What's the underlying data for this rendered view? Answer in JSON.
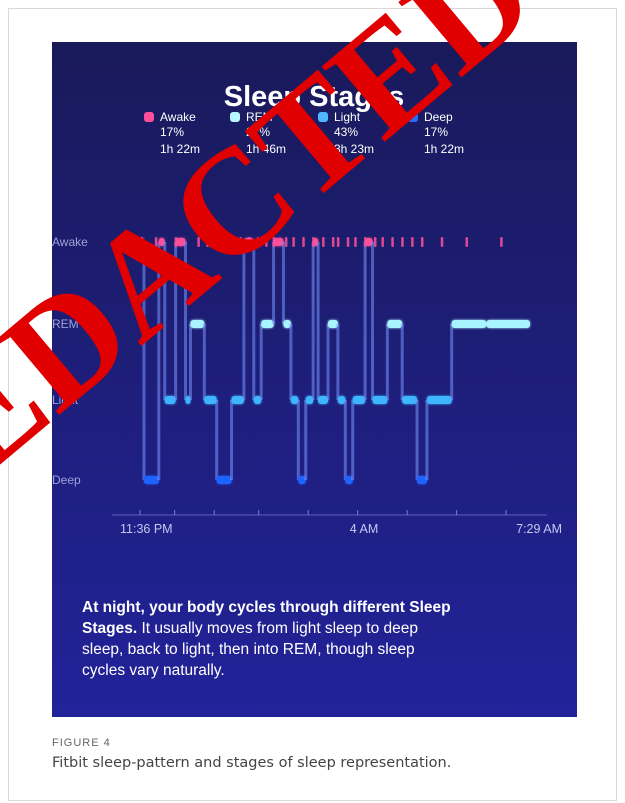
{
  "figure": {
    "caption_label": "FIGURE 4",
    "caption_text": "Fitbit sleep-pattern and stages of sleep representation."
  },
  "watermark": {
    "text": "REDACTED",
    "color": "#e00000"
  },
  "colors": {
    "background_top": "#191a5a",
    "background_bottom": "#22229a",
    "awake": "#ff4f9a",
    "rem": "#a8f4ff",
    "light": "#3db6ff",
    "deep": "#1e63ff"
  },
  "chart_data": {
    "type": "line",
    "title": "Sleep Stages",
    "legend": [
      {
        "stage": "Awake",
        "percent": "17%",
        "duration": "1h 22m",
        "color": "#ff4f9a"
      },
      {
        "stage": "REM",
        "percent": "22%",
        "duration": "1h 46m",
        "color": "#b9f6ff"
      },
      {
        "stage": "Light",
        "percent": "43%",
        "duration": "3h 23m",
        "color": "#4fb6ff"
      },
      {
        "stage": "Deep",
        "percent": "17%",
        "duration": "1h 22m",
        "color": "#2a6bff"
      }
    ],
    "y_categories": [
      "Awake",
      "REM",
      "Light",
      "Deep"
    ],
    "x_tick_labels": [
      "11:36 PM",
      "4 AM",
      "7:29 AM"
    ],
    "x_range_hours": [
      0,
      7.883
    ],
    "awake_markers_hours": [
      0.03,
      0.32,
      0.72,
      1.18,
      1.36,
      1.55,
      1.68,
      1.95,
      2.03,
      2.2,
      2.38,
      2.55,
      2.7,
      2.95,
      3.1,
      3.3,
      3.5,
      3.7,
      3.9,
      4.0,
      4.2,
      4.35,
      4.55,
      4.75,
      4.9,
      5.1,
      5.3,
      5.5,
      5.7,
      6.1,
      6.6,
      7.3
    ],
    "hypnogram": [
      {
        "start": 0.0,
        "end": 0.08,
        "stage": "Awake"
      },
      {
        "start": 0.08,
        "end": 0.38,
        "stage": "Deep"
      },
      {
        "start": 0.38,
        "end": 0.5,
        "stage": "Awake"
      },
      {
        "start": 0.5,
        "end": 0.72,
        "stage": "Light"
      },
      {
        "start": 0.72,
        "end": 0.92,
        "stage": "Awake"
      },
      {
        "start": 0.92,
        "end": 1.02,
        "stage": "Light"
      },
      {
        "start": 1.02,
        "end": 1.3,
        "stage": "REM"
      },
      {
        "start": 1.3,
        "end": 1.55,
        "stage": "Light"
      },
      {
        "start": 1.55,
        "end": 1.85,
        "stage": "Deep"
      },
      {
        "start": 1.85,
        "end": 2.1,
        "stage": "Light"
      },
      {
        "start": 2.1,
        "end": 2.3,
        "stage": "Awake"
      },
      {
        "start": 2.3,
        "end": 2.45,
        "stage": "Light"
      },
      {
        "start": 2.45,
        "end": 2.7,
        "stage": "REM"
      },
      {
        "start": 2.7,
        "end": 2.9,
        "stage": "Awake"
      },
      {
        "start": 2.9,
        "end": 3.05,
        "stage": "REM"
      },
      {
        "start": 3.05,
        "end": 3.2,
        "stage": "Light"
      },
      {
        "start": 3.2,
        "end": 3.35,
        "stage": "Deep"
      },
      {
        "start": 3.35,
        "end": 3.5,
        "stage": "Light"
      },
      {
        "start": 3.5,
        "end": 3.6,
        "stage": "Awake"
      },
      {
        "start": 3.6,
        "end": 3.8,
        "stage": "Light"
      },
      {
        "start": 3.8,
        "end": 4.0,
        "stage": "REM"
      },
      {
        "start": 4.0,
        "end": 4.15,
        "stage": "Light"
      },
      {
        "start": 4.15,
        "end": 4.3,
        "stage": "Deep"
      },
      {
        "start": 4.3,
        "end": 4.55,
        "stage": "Light"
      },
      {
        "start": 4.55,
        "end": 4.7,
        "stage": "Awake"
      },
      {
        "start": 4.7,
        "end": 5.0,
        "stage": "Light"
      },
      {
        "start": 5.0,
        "end": 5.3,
        "stage": "REM"
      },
      {
        "start": 5.3,
        "end": 5.6,
        "stage": "Light"
      },
      {
        "start": 5.6,
        "end": 5.8,
        "stage": "Deep"
      },
      {
        "start": 5.8,
        "end": 6.3,
        "stage": "Light"
      },
      {
        "start": 6.3,
        "end": 7.0,
        "stage": "REM"
      },
      {
        "start": 7.0,
        "end": 7.883,
        "stage": "REM"
      }
    ],
    "description": {
      "bold": "At night, your body cycles through different Sleep Stages.",
      "rest": " It usually moves from light sleep to deep sleep, back to light, then into REM, though sleep cycles vary naturally."
    }
  }
}
